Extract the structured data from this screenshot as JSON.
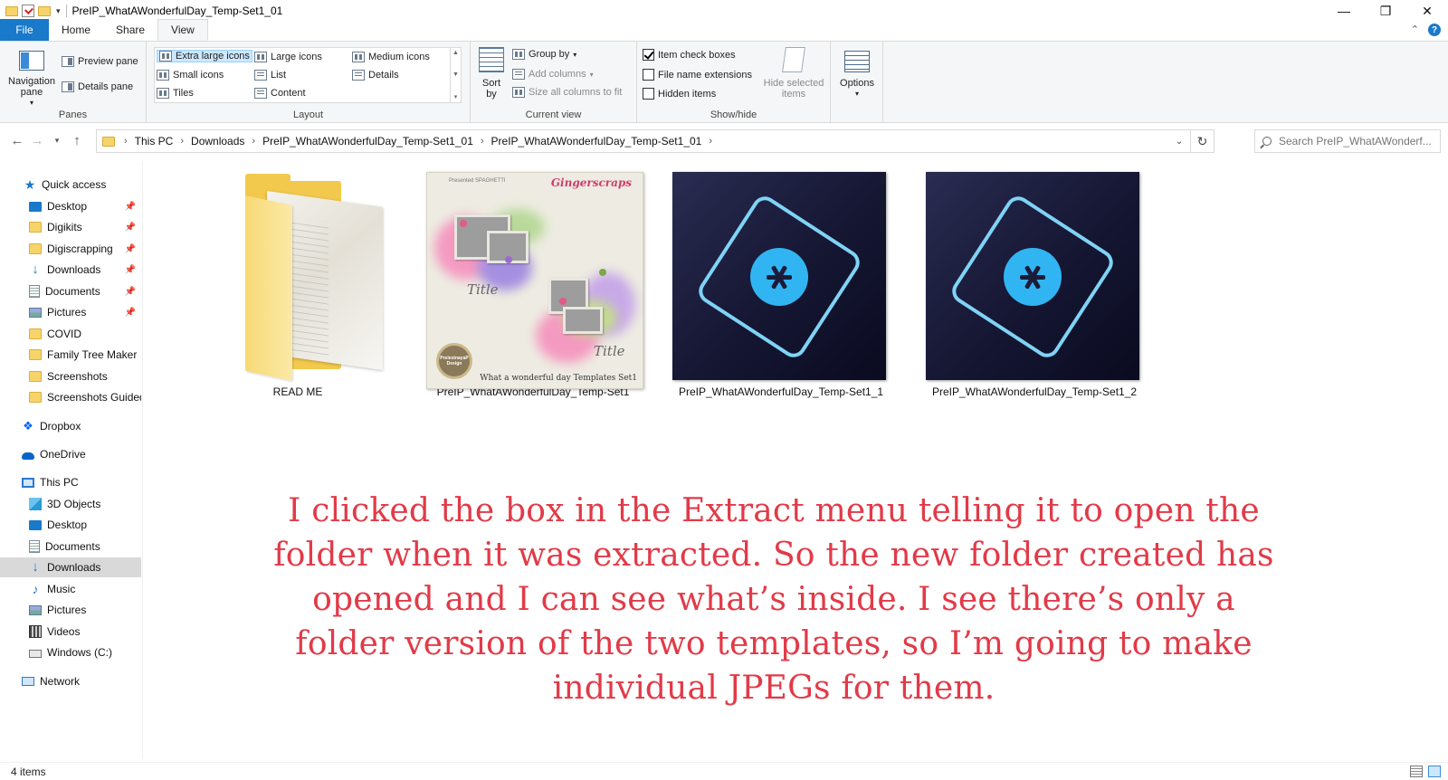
{
  "window": {
    "title": "PreIP_WhatAWonderfulDay_Temp-Set1_01",
    "minimize": "—",
    "maximize": "❐",
    "close": "✕"
  },
  "tabs": [
    {
      "label": "File"
    },
    {
      "label": "Home"
    },
    {
      "label": "Share"
    },
    {
      "label": "View"
    }
  ],
  "ribbon": {
    "panes": {
      "group": "Panes",
      "navigation_pane": "Navigation pane",
      "preview_pane": "Preview pane",
      "details_pane": "Details pane"
    },
    "layout": {
      "group": "Layout",
      "options": [
        "Extra large icons",
        "Large icons",
        "Medium icons",
        "Small icons",
        "List",
        "Details",
        "Tiles",
        "Content"
      ],
      "selected": "Extra large icons"
    },
    "current_view": {
      "group": "Current view",
      "sort_by": "Sort by",
      "group_by": "Group by",
      "add_columns": "Add columns",
      "size_all_columns": "Size all columns to fit"
    },
    "show_hide": {
      "group": "Show/hide",
      "item_check_boxes": {
        "label": "Item check boxes",
        "checked": true
      },
      "file_name_extensions": {
        "label": "File name extensions",
        "checked": false
      },
      "hidden_items": {
        "label": "Hidden items",
        "checked": false
      },
      "hide_selected_items": "Hide selected items"
    },
    "options": "Options"
  },
  "address": {
    "crumbs": [
      "This PC",
      "Downloads",
      "PreIP_WhatAWonderfulDay_Temp-Set1_01",
      "PreIP_WhatAWonderfulDay_Temp-Set1_01"
    ],
    "search_placeholder": "Search PreIP_WhatAWonderf..."
  },
  "sidebar": {
    "quick_access": "Quick access",
    "quick_items": [
      {
        "label": "Desktop",
        "icon": "desktop-icon",
        "pinned": true
      },
      {
        "label": "Digikits",
        "icon": "folder-icon",
        "pinned": true
      },
      {
        "label": "Digiscrapping",
        "icon": "folder-icon",
        "pinned": true
      },
      {
        "label": "Downloads",
        "icon": "download-icon",
        "pinned": true
      },
      {
        "label": "Documents",
        "icon": "documents-icon",
        "pinned": true
      },
      {
        "label": "Pictures",
        "icon": "pictures-icon",
        "pinned": true
      },
      {
        "label": "COVID",
        "icon": "folder-icon",
        "pinned": false
      },
      {
        "label": "Family Tree Maker",
        "icon": "folder-icon",
        "pinned": false
      },
      {
        "label": "Screenshots",
        "icon": "folder-icon",
        "pinned": false
      },
      {
        "label": "Screenshots Guided",
        "icon": "folder-icon",
        "pinned": false
      }
    ],
    "dropbox": "Dropbox",
    "onedrive": "OneDrive",
    "this_pc": "This PC",
    "pc_items": [
      {
        "label": "3D Objects",
        "icon": "cube-icon"
      },
      {
        "label": "Desktop",
        "icon": "desktop-icon"
      },
      {
        "label": "Documents",
        "icon": "documents-icon"
      },
      {
        "label": "Downloads",
        "icon": "download-icon",
        "selected": true
      },
      {
        "label": "Music",
        "icon": "music-icon"
      },
      {
        "label": "Pictures",
        "icon": "pictures-icon"
      },
      {
        "label": "Videos",
        "icon": "videos-icon"
      },
      {
        "label": "Windows (C:)",
        "icon": "drive-icon"
      }
    ],
    "network": "Network"
  },
  "files": [
    {
      "name": "READ ME",
      "type": "folder"
    },
    {
      "name": "PreIP_WhatAWonderfulDay_Temp-Set1",
      "type": "image"
    },
    {
      "name": "PreIP_WhatAWonderfulDay_Temp-Set1_1",
      "type": "psd"
    },
    {
      "name": "PreIP_WhatAWonderfulDay_Temp-Set1_2",
      "type": "psd"
    }
  ],
  "thumbnail_text": {
    "brand": "Gingerscraps",
    "designer": "Presented\nSPAGHETTI",
    "title": "Title",
    "caption": "What a wonderful day Templates Set1",
    "seal": "PrelestnayaP Design"
  },
  "overlay_text": "I clicked the box in the Extract menu telling it to open the folder when it was extracted. So the new folder created has opened and I can see what’s inside. I see there’s only a folder version of the two templates, so I’m going to make individual JPEGs for them.",
  "status": {
    "item_count": "4 items"
  },
  "colors": {
    "file_tab": "#1979ca",
    "overlay_text": "#e23a48",
    "pse_background": "#151632",
    "pse_accent": "#31b5f2"
  }
}
